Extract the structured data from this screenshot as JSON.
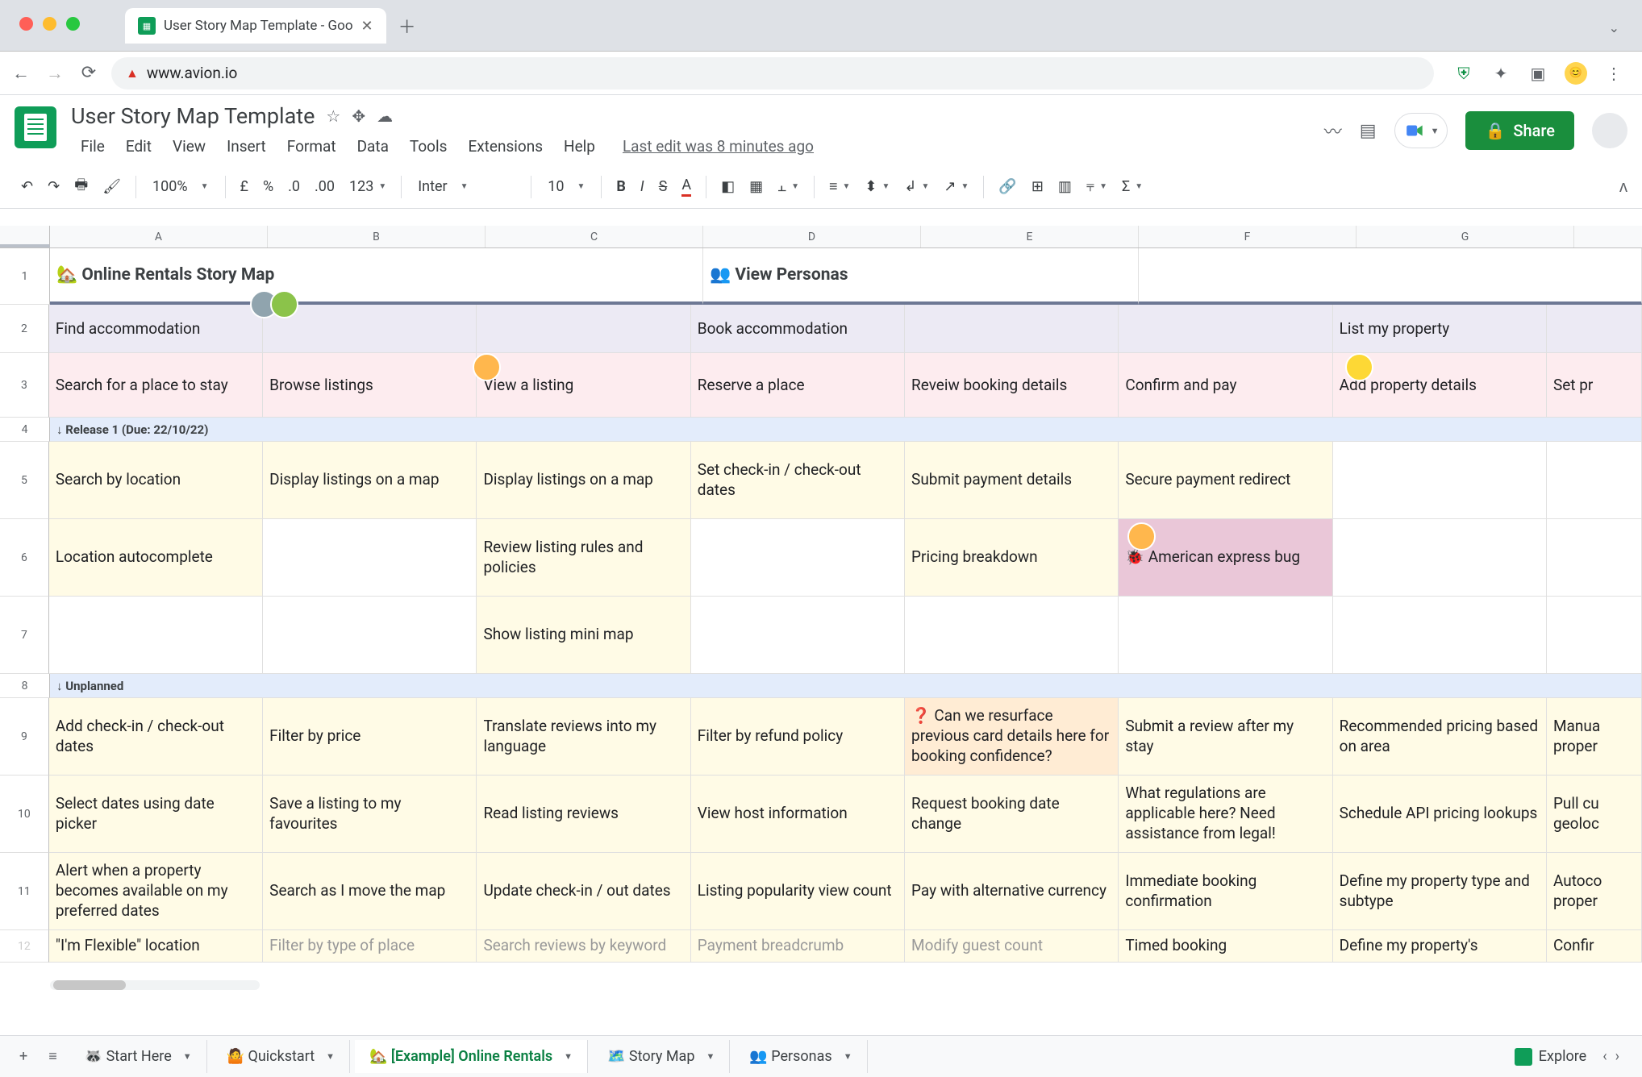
{
  "browser": {
    "tab_title": "User Story Map Template - Goo",
    "url": "www.avion.io"
  },
  "doc": {
    "title": "User Story Map Template",
    "last_edit": "Last edit was 8 minutes ago",
    "menus": [
      "File",
      "Edit",
      "View",
      "Insert",
      "Format",
      "Data",
      "Tools",
      "Extensions",
      "Help"
    ],
    "share_label": "Share"
  },
  "toolbar": {
    "zoom": "100%",
    "font": "Inter",
    "font_size": "10"
  },
  "columns": [
    "A",
    "B",
    "C",
    "D",
    "E",
    "F",
    "G"
  ],
  "row_numbers": [
    "1",
    "2",
    "3",
    "4",
    "5",
    "6",
    "7",
    "8",
    "9",
    "10",
    "11",
    "12"
  ],
  "row1": {
    "title": "🏡  Online Rentals Story Map",
    "personas": "👥  View Personas"
  },
  "row2": {
    "A": "Find accommodation",
    "B": "",
    "C": "",
    "D": "Book accommodation",
    "E": "",
    "F": "",
    "G": "List my property",
    "H": ""
  },
  "row3": {
    "A": "Search for a place to stay",
    "B": "Browse listings",
    "C": "View a listing",
    "D": "Reserve a place",
    "E": "Reveiw booking details",
    "F": "Confirm and pay",
    "G": "Add property details",
    "H": "Set pr"
  },
  "row4": {
    "label": "↓ Release 1 (Due: 22/10/22)"
  },
  "row5": {
    "A": "Search by location",
    "B": "Display listings on a map",
    "C": "Display listings on a map",
    "D": "Set check-in / check-out dates",
    "E": "Submit payment details",
    "F": "Secure payment redirect",
    "G": "",
    "H": ""
  },
  "row6": {
    "A": "Location autocomplete",
    "B": "",
    "C": "Review listing rules and policies",
    "D": "",
    "E": "Pricing breakdown",
    "F": "🐞  American express bug",
    "G": "",
    "H": ""
  },
  "row7": {
    "A": "",
    "B": "",
    "C": "Show listing mini map",
    "D": "",
    "E": "",
    "F": "",
    "G": "",
    "H": ""
  },
  "row8": {
    "label": "↓ Unplanned"
  },
  "row9": {
    "A": "Add check-in / check-out dates",
    "B": "Filter by price",
    "C": "Translate reviews into my language",
    "D": "Filter by refund policy",
    "E": "❓  Can we resurface previous card details here for booking confidence?",
    "F": "Submit a review after my stay",
    "G": "Recommended pricing based on area",
    "H": "Manua\nproper"
  },
  "row10": {
    "A": "Select dates using date picker",
    "B": "Save a listing to my favourites",
    "C": "Read listing reviews",
    "D": "View host information",
    "E": "Request booking date change",
    "F": "What regulations are applicable here? Need assistance from legal!",
    "G": "Schedule API pricing lookups",
    "H": "Pull cu\ngeoloc"
  },
  "row11": {
    "A": "Alert when a property becomes available on my preferred dates",
    "B": "Search as I move the map",
    "C": "Update check-in / out dates",
    "D": "Listing popularity view count",
    "E": "Pay with alternative currency",
    "F": "Immediate booking confirmation",
    "G": "Define my property type and subtype",
    "H": "Autoco\nproper"
  },
  "row12": {
    "A": "\"I'm Flexible\" location",
    "B": "Filter by type of place",
    "C": "Search reviews by keyword",
    "D": "Payment breadcrumb",
    "E": "Modify guest count",
    "F": "Timed booking",
    "G": "Define my property's",
    "H": "Confir"
  },
  "sheet_tabs": {
    "add": "+",
    "items": [
      "🦝 Start Here",
      "🤷 Quickstart",
      "🏡 [Example] Online Rentals",
      "🗺️ Story Map",
      "👥 Personas"
    ],
    "active_index": 2,
    "explore": "Explore"
  }
}
